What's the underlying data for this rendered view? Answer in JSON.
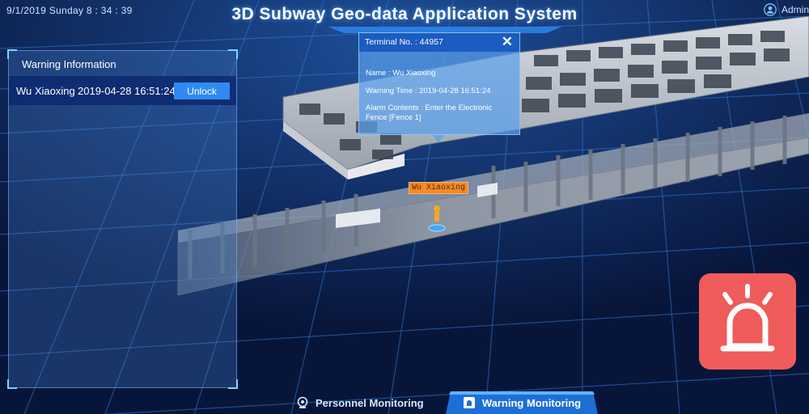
{
  "header": {
    "datetime": "9/1/2019 Sunday  8 : 34 : 39",
    "title": "3D Subway Geo-data Application System",
    "user": "Admin"
  },
  "warning_panel": {
    "title": "Warning Information",
    "rows": [
      {
        "name": "Wu Xiaoxing",
        "time": "2019-04-28 16:51:24",
        "action": "Unlock"
      }
    ]
  },
  "popup": {
    "terminal": "Terminal No. : 44957",
    "name": "Name : Wu Xiaoxing",
    "warning_time": "Warning Time : 2019-04-28 16:51:24",
    "alarm_contents": "Alarm Contents : Enter the Electronic Fence [Fence 1]",
    "close_symbol": "✕"
  },
  "person_tag": "Wu Xiaoxing",
  "tabs": [
    {
      "label": "Personnel Monitoring",
      "icon": "camera-icon",
      "active": false
    },
    {
      "label": "Warning Monitoring",
      "icon": "alarm-icon",
      "active": true
    }
  ],
  "colors": {
    "background": "#0a1a3d",
    "grid": "#2e7ad6",
    "accent": "#2f8af2",
    "alarm": "#f05b5b",
    "tag": "#f08a2a"
  },
  "icons": {
    "admin": "user-icon",
    "alarm_button": "alarm-light-icon"
  }
}
